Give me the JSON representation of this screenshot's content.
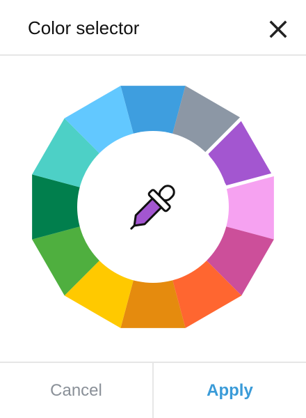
{
  "dialog": {
    "title": "Color selector",
    "close_icon": "close-icon",
    "cancel_label": "Cancel",
    "apply_label": "Apply",
    "center_icon": "eyedropper-icon",
    "picked_color": "#A356D0"
  },
  "swatches": [
    {
      "name": "blue",
      "color": "#3E9EDF"
    },
    {
      "name": "slate",
      "color": "#8C97A5"
    },
    {
      "name": "purple",
      "color": "#A356D0",
      "selected": true
    },
    {
      "name": "pink",
      "color": "#F6A2F1"
    },
    {
      "name": "magenta",
      "color": "#CC4F9A"
    },
    {
      "name": "red-orange",
      "color": "#FF6630"
    },
    {
      "name": "orange",
      "color": "#E58B0E"
    },
    {
      "name": "yellow",
      "color": "#FFC900"
    },
    {
      "name": "green",
      "color": "#4FAF3F"
    },
    {
      "name": "dark-green",
      "color": "#017F4D"
    },
    {
      "name": "teal",
      "color": "#4DD0C6"
    },
    {
      "name": "light-blue",
      "color": "#62C8FF"
    }
  ]
}
